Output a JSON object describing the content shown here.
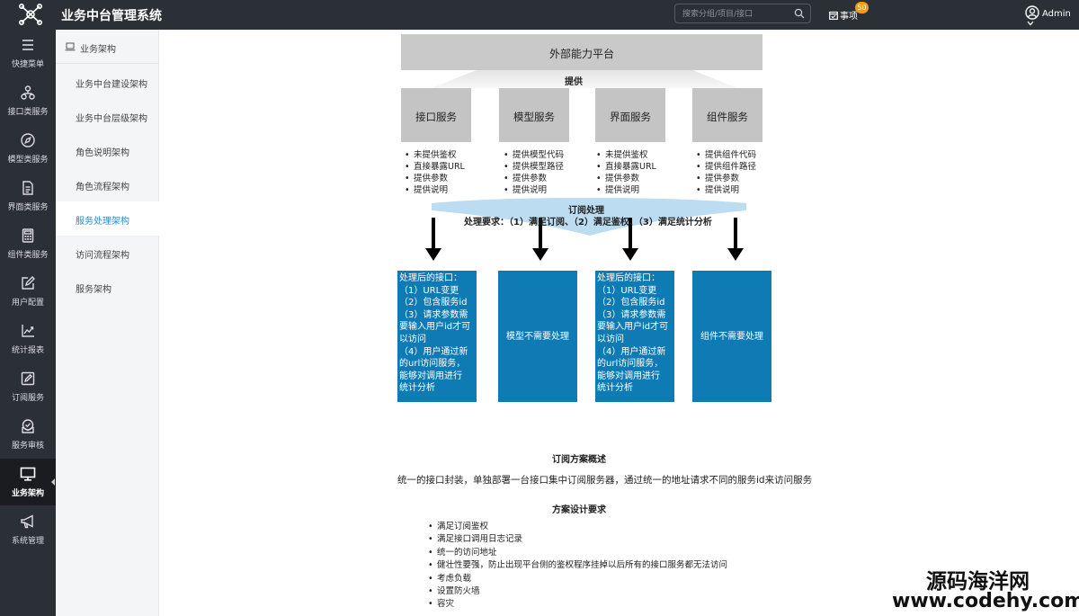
{
  "app": {
    "title": "业务中台管理系统"
  },
  "header": {
    "search_placeholder": "搜索分组/项目/接口",
    "todo_label": "事项",
    "todo_count": "50",
    "user_name": "Admin"
  },
  "rail": {
    "items": [
      {
        "label": "快捷菜单",
        "icon": "menu-icon"
      },
      {
        "label": "接口类服务",
        "icon": "nodes-icon"
      },
      {
        "label": "模型类服务",
        "icon": "compass-icon"
      },
      {
        "label": "界面类服务",
        "icon": "document-icon"
      },
      {
        "label": "组件类服务",
        "icon": "calculator-icon"
      },
      {
        "label": "用户配置",
        "icon": "edit-icon"
      },
      {
        "label": "统计报表",
        "icon": "chart-icon"
      },
      {
        "label": "订阅服务",
        "icon": "pencil-icon"
      },
      {
        "label": "服务审核",
        "icon": "mail-icon"
      },
      {
        "label": "业务架构",
        "icon": "monitor-icon"
      },
      {
        "label": "系统管理",
        "icon": "megaphone-icon"
      }
    ],
    "active_index": 9
  },
  "subnav": {
    "title": "业务架构",
    "items": [
      {
        "label": "业务中台建设架构"
      },
      {
        "label": "业务中台层级架构"
      },
      {
        "label": "角色说明架构"
      },
      {
        "label": "角色流程架构"
      },
      {
        "label": "服务处理架构"
      },
      {
        "label": "访问流程架构"
      },
      {
        "label": "服务架构"
      }
    ],
    "active_index": 4
  },
  "diagram": {
    "platform": "外部能力平台",
    "provide": "提供",
    "services": [
      {
        "name": "接口服务",
        "bullets": [
          "未提供鉴权",
          "直接暴露URL",
          "提供参数",
          "提供说明"
        ]
      },
      {
        "name": "模型服务",
        "bullets": [
          "提供模型代码",
          "提供模型路径",
          "提供参数",
          "提供说明"
        ]
      },
      {
        "name": "界面服务",
        "bullets": [
          "未提供鉴权",
          "直接暴露URL",
          "提供参数",
          "提供说明"
        ]
      },
      {
        "name": "组件服务",
        "bullets": [
          "提供组件代码",
          "提供组件路径",
          "提供参数",
          "提供说明"
        ]
      }
    ],
    "subscription_title": "订阅处理",
    "subscription_requirements": "处理要求：（1）满足订阅、（2）满足鉴权、（3）满足统计分析",
    "results": [
      {
        "lines": [
          "处理后的接口：",
          "（1）URL变更",
          "（2）包含服务id",
          "（3）请求参数需",
          "要输入用户id才可",
          "以访问",
          "（4）用户通过新",
          "的url访问服务，",
          "能够对调用进行",
          "统计分析"
        ]
      },
      {
        "text": "模型不需要处理"
      },
      {
        "lines": [
          "处理后的接口：",
          "（1）URL变更",
          "（2）包含服务id",
          "（3）请求参数需",
          "要输入用户id才可",
          "以访问",
          "（4）用户通过新",
          "的url访问服务，",
          "能够对调用进行",
          "统计分析"
        ]
      },
      {
        "text": "组件不需要处理"
      }
    ],
    "colors": {
      "gray_box": "#c4c4c4",
      "result_box": "#0f7bb5",
      "band": "#bcdcf2"
    }
  },
  "overview": {
    "title": "订阅方案概述",
    "text": "统一的接口封装，单独部署一台接口集中订阅服务器，通过统一的地址请求不同的服务id来访问服务"
  },
  "requirements": {
    "title": "方案设计要求",
    "items": [
      "满足订阅鉴权",
      "满足接口调用日志记录",
      "统一的访问地址",
      "健壮性要强，防止出现平台侧的鉴权程序挂掉以后所有的接口服务都无法访问",
      "考虑负载",
      "设置防火墙",
      "容灾"
    ]
  },
  "watermark": {
    "line1": "源码海洋网",
    "line2": "www.codehy.com"
  }
}
